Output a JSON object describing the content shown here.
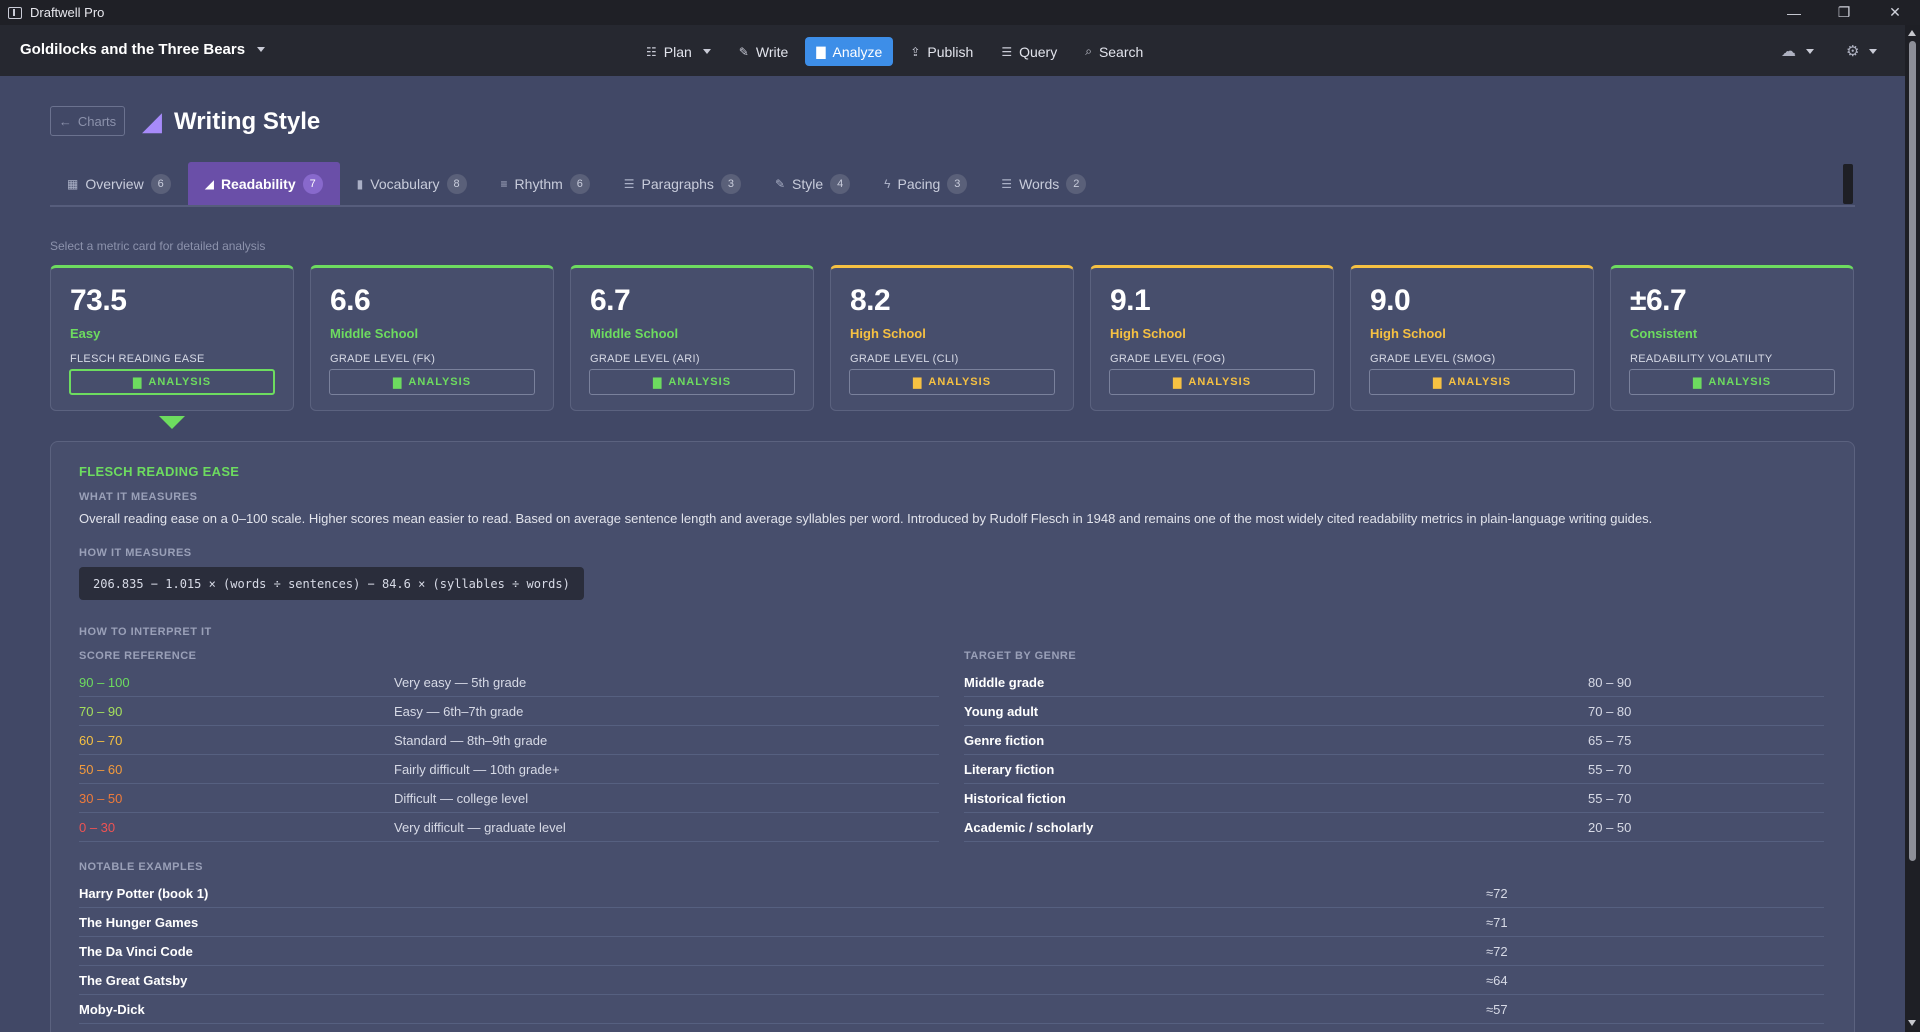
{
  "window": {
    "app_name": "Draftwell Pro"
  },
  "project": {
    "title": "Goldilocks and the Three Bears"
  },
  "nav": [
    {
      "label": "Plan",
      "icon": "sitemap-icon",
      "has_menu": true
    },
    {
      "label": "Write",
      "icon": "pen-icon"
    },
    {
      "label": "Analyze",
      "icon": "chart-bar-icon",
      "active": true
    },
    {
      "label": "Publish",
      "icon": "upload-icon"
    },
    {
      "label": "Query",
      "icon": "table-icon"
    },
    {
      "label": "Search",
      "icon": "search-icon"
    }
  ],
  "header": {
    "back_label": "Charts",
    "title": "Writing Style"
  },
  "tabs": [
    {
      "label": "Overview",
      "count": "6"
    },
    {
      "label": "Readability",
      "count": "7",
      "active": true
    },
    {
      "label": "Vocabulary",
      "count": "8"
    },
    {
      "label": "Rhythm",
      "count": "6"
    },
    {
      "label": "Paragraphs",
      "count": "3"
    },
    {
      "label": "Style",
      "count": "4"
    },
    {
      "label": "Pacing",
      "count": "3"
    },
    {
      "label": "Words",
      "count": "2"
    }
  ],
  "hint": "Select a metric card for detailed analysis",
  "cards": [
    {
      "value": "73.5",
      "level": "Easy",
      "label": "FLESCH READING EASE",
      "button": "ANALYSIS",
      "status": "good",
      "selected": true
    },
    {
      "value": "6.6",
      "level": "Middle School",
      "label": "GRADE LEVEL (FK)",
      "button": "ANALYSIS",
      "status": "good"
    },
    {
      "value": "6.7",
      "level": "Middle School",
      "label": "GRADE LEVEL (ARI)",
      "button": "ANALYSIS",
      "status": "good"
    },
    {
      "value": "8.2",
      "level": "High School",
      "label": "GRADE LEVEL (CLI)",
      "button": "ANALYSIS",
      "status": "warn"
    },
    {
      "value": "9.1",
      "level": "High School",
      "label": "GRADE LEVEL (FOG)",
      "button": "ANALYSIS",
      "status": "warn"
    },
    {
      "value": "9.0",
      "level": "High School",
      "label": "GRADE LEVEL (SMOG)",
      "button": "ANALYSIS",
      "status": "warn"
    },
    {
      "value": "±6.7",
      "level": "Consistent",
      "label": "READABILITY VOLATILITY",
      "button": "ANALYSIS",
      "status": "good"
    }
  ],
  "detail": {
    "title": "FLESCH READING EASE",
    "what_heading": "WHAT IT MEASURES",
    "what_text": "Overall reading ease on a 0–100 scale. Higher scores mean easier to read. Based on average sentence length and average syllables per word. Introduced by Rudolf Flesch in 1948 and remains one of the most widely cited readability metrics in plain-language writing guides.",
    "how_heading": "HOW IT MEASURES",
    "formula": "206.835 − 1.015 × (words ÷ sentences) − 84.6 × (syllables ÷ words)",
    "interpret_heading": "HOW TO INTERPRET IT",
    "score_heading": "SCORE REFERENCE",
    "scores": [
      {
        "range": "90 – 100",
        "desc": "Very easy — 5th grade",
        "color": "#6ddc5f"
      },
      {
        "range": "70 – 90",
        "desc": "Easy — 6th–7th grade",
        "color": "#a5e05c"
      },
      {
        "range": "60 – 70",
        "desc": "Standard — 8th–9th grade",
        "color": "#f6c142"
      },
      {
        "range": "50 – 60",
        "desc": "Fairly difficult — 10th grade+",
        "color": "#f39a3c"
      },
      {
        "range": "30 – 50",
        "desc": "Difficult — college level",
        "color": "#ef7b3a"
      },
      {
        "range": "0 – 30",
        "desc": "Very difficult — graduate level",
        "color": "#ee5353"
      }
    ],
    "genre_heading": "TARGET BY GENRE",
    "genres": [
      {
        "genre": "Middle grade",
        "range": "80 – 90"
      },
      {
        "genre": "Young adult",
        "range": "70 – 80"
      },
      {
        "genre": "Genre fiction",
        "range": "65 – 75"
      },
      {
        "genre": "Literary fiction",
        "range": "55 – 70"
      },
      {
        "genre": "Historical fiction",
        "range": "55 – 70"
      },
      {
        "genre": "Academic / scholarly",
        "range": "20 – 50"
      }
    ],
    "examples_heading": "NOTABLE EXAMPLES",
    "examples": [
      {
        "title": "Harry Potter (book 1)",
        "score": "≈72"
      },
      {
        "title": "The Hunger Games",
        "score": "≈71"
      },
      {
        "title": "The Da Vinci Code",
        "score": "≈72"
      },
      {
        "title": "The Great Gatsby",
        "score": "≈64"
      },
      {
        "title": "Moby-Dick",
        "score": "≈57"
      }
    ]
  }
}
